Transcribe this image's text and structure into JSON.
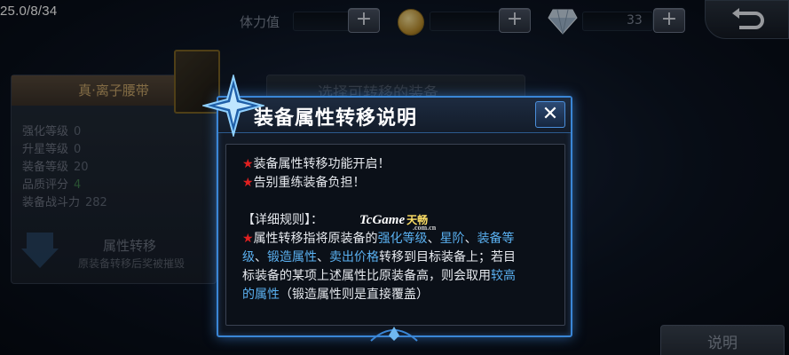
{
  "hud": {
    "fps_text": "25.0/8/34",
    "stamina_label": "体力值",
    "gem_count": "33",
    "plus_symbol": "+"
  },
  "background": {
    "item_panel": {
      "title": "真·离子腰带",
      "stats": [
        {
          "label": "强化等级",
          "value": "0"
        },
        {
          "label": "升星等级",
          "value": "0"
        },
        {
          "label": "装备等级",
          "value": "20"
        },
        {
          "label": "品质评分",
          "value": "4"
        },
        {
          "label": "装备战斗力",
          "value": "282"
        }
      ]
    },
    "section_title": "属性转移",
    "section_subtitle": "原装备转移后奖被摧毁",
    "right_panel_title": "选择可转移的装备",
    "desc_button": "说明"
  },
  "dialog": {
    "title": "装备属性转移说明",
    "close_symbol": "✕",
    "lines": [
      "装备属性转移功能开启！",
      "告别重练装备负担！"
    ],
    "rules_heading": "【详细规则】：",
    "rule_parts": {
      "p1": "属性转移指将原装备的",
      "h1": "强化等级",
      "s1": "、",
      "h2": "星阶",
      "s2": "、",
      "h3a": "装备等",
      "h3b": "级",
      "s3": "、",
      "h4": "锻造属性",
      "s4": "、",
      "h5": "卖出价格",
      "p2": "转移到目标装备上；若目",
      "p3": "标装备的某项上述属性比原装备高，则会取用",
      "h6a": "较高",
      "h6b": "的属性",
      "p4": "（锻造属性则是直接覆盖）"
    },
    "star_symbol": "★"
  },
  "watermark": {
    "brand": "TcGame",
    "cn": "天畅",
    "domain": ".com.cn"
  },
  "colors": {
    "highlight": "#5ab0f0",
    "star": "#e02020",
    "dialog_border": "#3a86d6"
  }
}
